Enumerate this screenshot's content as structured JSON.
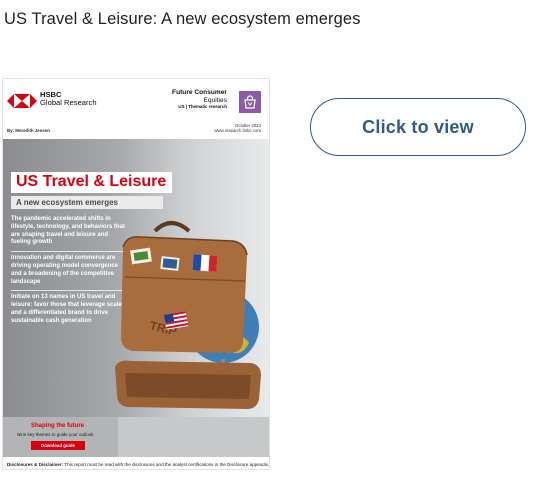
{
  "page": {
    "heading": "US Travel & Leisure: A new ecosystem emerges",
    "click_button_label": "Click to view"
  },
  "cover": {
    "logo": {
      "brand": "HSBC",
      "division": "Global Research"
    },
    "series": {
      "title_line1": "Future Consumer",
      "title_line2": "Equities",
      "subtitle": "US | Thematic research"
    },
    "date": "October 2023",
    "website": "www.research.hsbc.com",
    "author": "By: Meredith Jensen",
    "title": "US Travel & Leisure",
    "subtitle": "A new ecosystem emerges",
    "bullets": [
      "The pandemic accelerated shifts in lifestyle, technology, and behaviors that are shaping travel and leisure and fueling growth",
      "Innovation and digital commerce are driving operating model convergence and a broadening of the competitive landscape",
      "Initiate on 13 names in US travel and leisure: favor those that leverage scale and a differentiated brand to drive sustainable cash generation"
    ],
    "cta": {
      "title": "Shaping the future",
      "text": "Nine key themes to guide your outlook",
      "button": "Download guide"
    },
    "disclaimer": {
      "label": "Disclosures & Disclaimer:",
      "text": " This report must be read with the disclosures and the analyst certifications in the Disclosure appendix, and with the Disclaimer, which forms part of it."
    },
    "illustration_text": "TRIP"
  },
  "colors": {
    "hsbc_red": "#db0011",
    "button_border": "#305a85",
    "series_tile": "#8d5aa8",
    "suitcase": "#a86c3d"
  },
  "icons": {
    "logo": "hsbc-hexagon-logo",
    "series_tile": "shopping-bag-icon",
    "illustration": "suitcase-globe-illustration"
  }
}
